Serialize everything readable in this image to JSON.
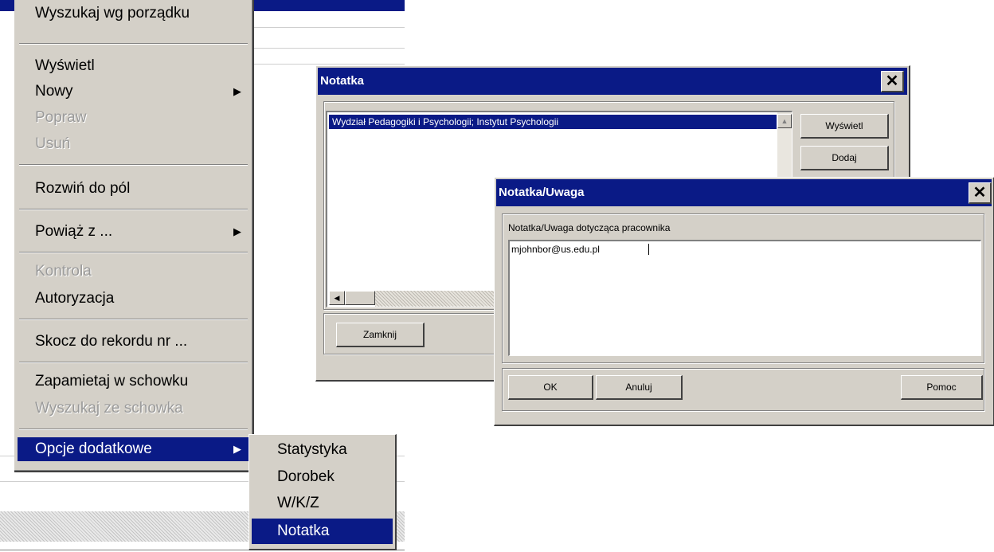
{
  "menu": {
    "items": [
      {
        "label": "Wyszukaj wg porządku",
        "disabled": false
      },
      {
        "label": "Wyświetl",
        "disabled": false
      },
      {
        "label": "Nowy",
        "disabled": false,
        "submenu": true
      },
      {
        "label": "Popraw",
        "disabled": true
      },
      {
        "label": "Usuń",
        "disabled": true
      },
      {
        "label": "Rozwiń do pól",
        "disabled": false
      },
      {
        "label": "Powiąż z ...",
        "disabled": false,
        "submenu": true
      },
      {
        "label": "Kontrola",
        "disabled": true
      },
      {
        "label": "Autoryzacja",
        "disabled": false
      },
      {
        "label": "Skocz do rekordu nr ...",
        "disabled": false
      },
      {
        "label": "Zapamietaj w schowku",
        "disabled": false
      },
      {
        "label": "Wyszukaj ze schowka",
        "disabled": true
      },
      {
        "label": "Opcje dodatkowe",
        "disabled": false,
        "submenu": true,
        "selected": true
      }
    ],
    "arrow_glyph": "▶"
  },
  "submenu": {
    "items": [
      {
        "label": "Statystyka"
      },
      {
        "label": "Dorobek"
      },
      {
        "label": "W/K/Z"
      },
      {
        "label": "Notatka",
        "selected": true
      }
    ]
  },
  "notatka_dialog": {
    "title": "Notatka",
    "close_glyph": "✕",
    "list_items": [
      "Wydział Pedagogiki i Psychologii; Instytut Psychologii"
    ],
    "buttons": {
      "view": "Wyświetl",
      "add": "Dodaj",
      "close": "Zamknij"
    }
  },
  "uwaga_dialog": {
    "title": "Notatka/Uwaga",
    "close_glyph": "✕",
    "field_label": "Notatka/Uwaga dotycząca pracownika",
    "field_value": "mjohnbor@us.edu.pl",
    "buttons": {
      "ok": "OK",
      "cancel": "Anuluj",
      "help": "Pomoc"
    }
  },
  "colors": {
    "title_bar": "#0a1a86",
    "face": "#d4d0c8",
    "selection": "#0a1a86"
  }
}
